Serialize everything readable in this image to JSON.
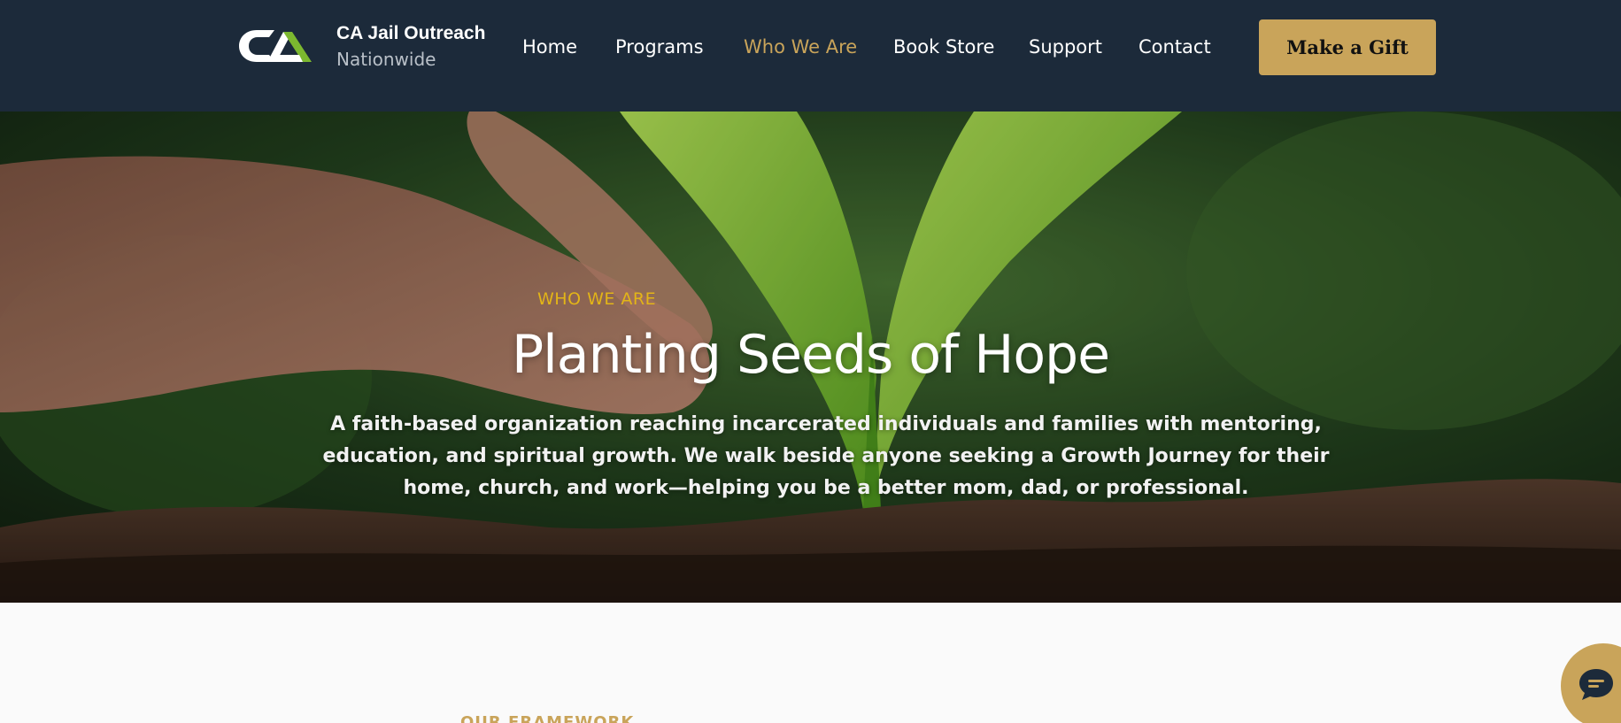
{
  "header": {
    "brand_name": "CA Jail Outreach",
    "brand_sub": "Nationwide",
    "nav": [
      {
        "label": "Home",
        "active": false
      },
      {
        "label": "Programs",
        "active": false
      },
      {
        "label": "Who We Are",
        "active": true
      },
      {
        "label": "Book Store",
        "active": false
      },
      {
        "label": "Support",
        "active": false
      },
      {
        "label": "Contact",
        "active": false
      }
    ],
    "gift_label": "Make a Gift"
  },
  "hero": {
    "eyebrow": "WHO WE ARE",
    "title": "Planting Seeds of Hope",
    "description": "A faith-based organization reaching incarcerated individuals and families with mentoring, education, and spiritual growth. We walk beside anyone seeking a Growth Journey for their home, church, and work—helping you be a better mom, dad, or professional."
  },
  "next_section": {
    "eyebrow": "OUR FRAMEWORK"
  },
  "chat": {
    "icon": "chat-bubble-icon"
  },
  "colors": {
    "header_bg": "#1c2a3a",
    "accent_gold": "#c9a45a",
    "eyebrow_yellow": "#e3b517",
    "logo_green": "#7cb82f"
  }
}
